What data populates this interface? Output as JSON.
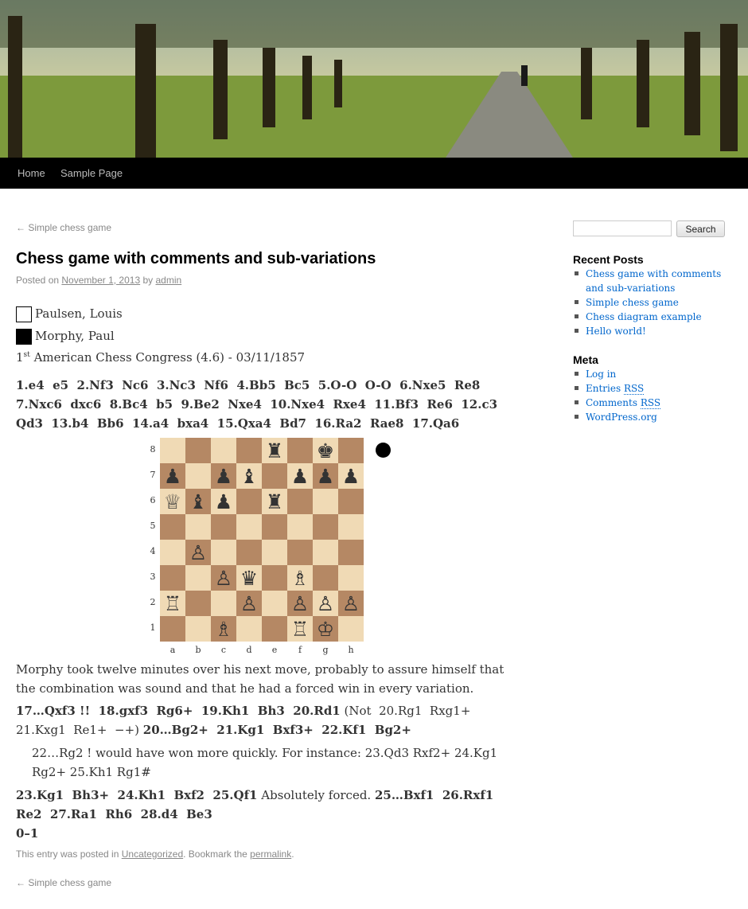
{
  "nav": {
    "items": [
      "Home",
      "Sample Page"
    ]
  },
  "post_nav": {
    "previous": "← Simple chess game"
  },
  "post": {
    "title": "Chess game with comments and sub-variations",
    "posted_on": "Posted on",
    "date": "November 1, 2013",
    "by": "by",
    "author": "admin",
    "white_player": "Paulsen, Louis",
    "black_player": "Morphy, Paul",
    "event_ordinal": "1",
    "event_ordinal_suffix": "st",
    "event_rest": "American Chess Congress (4.6) - 03/11/1857",
    "moves_1": "1.e4  e5  2.Nf3  Nc6  3.Nc3  Nf6  4.Bb5  Bc5  5.O-O  O-O  6.Nxe5  Re8  7.Nxc6  dxc6  8.Bc4  b5  9.Be2  Nxe4  10.Nxe4  Rxe4  11.Bf3  Re6  12.c3  Qd3  13.b4  Bb6  14.a4  bxa4  15.Qxa4  Bd7  16.Ra2  Rae8  17.Qa6",
    "comment_1": "Morphy took twelve minutes over his next move, probably to assure himself that the combination was sound and that he had a forced win in every variation.",
    "moves_2a": "17…Qxf3 !!  18.gxf3  Rg6+  19.Kh1  Bh3  20.Rd1",
    "variation_1": " (Not  20.Rg1  Rxg1+  21.Kxg1  Re1+  −+) ",
    "moves_2b": "20…Bg2+  21.Kg1  Bxf3+  22.Kf1  Bg2+",
    "sub_variation": "22…Rg2 !  would have won more quickly. For instance:  23.Qd3  Rxf2+  24.Kg1  Rg2+  25.Kh1  Rg1#",
    "moves_3a": "23.Kg1  Bh3+  24.Kh1  Bxf2  25.Qf1",
    "comment_2": " Absolutely forced. ",
    "moves_3b": "25…Bxf1  26.Rxf1  Re2  27.Ra1  Rh6  28.d4  Be3",
    "result": "0–1",
    "footer_1": "This entry was posted in ",
    "category": "Uncategorized",
    "footer_2": ". Bookmark the ",
    "permalink": "permalink",
    "footer_3": "."
  },
  "board": {
    "ranks": [
      "8",
      "7",
      "6",
      "5",
      "4",
      "3",
      "2",
      "1"
    ],
    "files": [
      "a",
      "b",
      "c",
      "d",
      "e",
      "f",
      "g",
      "h"
    ],
    "rows": [
      [
        "",
        "",
        "",
        "",
        "♜",
        "",
        "♚",
        ""
      ],
      [
        "♟",
        "",
        "♟",
        "♝",
        "",
        "♟",
        "♟",
        "♟"
      ],
      [
        "♕",
        "♝",
        "♟",
        "",
        "♜",
        "",
        "",
        ""
      ],
      [
        "",
        "",
        "",
        "",
        "",
        "",
        "",
        ""
      ],
      [
        "",
        "♙",
        "",
        "",
        "",
        "",
        "",
        ""
      ],
      [
        "",
        "",
        "♙",
        "♛",
        "",
        "♗",
        "",
        ""
      ],
      [
        "♖",
        "",
        "",
        "♙",
        "",
        "♙",
        "♙",
        "♙"
      ],
      [
        "",
        "",
        "♗",
        "",
        "",
        "♖",
        "♔",
        ""
      ]
    ],
    "light_color": "#f0dab5",
    "dark_color": "#b58864",
    "to_move": "black"
  },
  "sidebar": {
    "search_button": "Search",
    "recent_posts_title": "Recent Posts",
    "recent_posts": [
      "Chess game with comments and sub-variations",
      "Simple chess game",
      "Chess diagram example",
      "Hello world!"
    ],
    "meta_title": "Meta",
    "meta_links": [
      "Log in",
      "Entries",
      "Comments",
      "WordPress.org"
    ],
    "rss": "RSS"
  }
}
